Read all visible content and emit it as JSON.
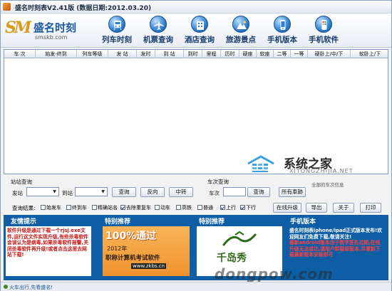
{
  "window": {
    "title": "盛名时刻表V2.41版 (数据日期:2012.03.20)"
  },
  "logo": {
    "mark": "SM",
    "name": "盛名时刻",
    "url": "smskb.com"
  },
  "nav": [
    {
      "label": "列车时刻",
      "icon": "train-icon"
    },
    {
      "label": "机票查询",
      "icon": "airplane-icon"
    },
    {
      "label": "酒店查询",
      "icon": "hotel-icon"
    },
    {
      "label": "旅游景点",
      "icon": "scenery-icon"
    },
    {
      "label": "手机版本",
      "icon": "phone-icon"
    },
    {
      "label": "手机软件",
      "icon": "mobile-app-icon"
    }
  ],
  "table": {
    "columns": [
      "车  次",
      "始发-终到",
      "列车等级",
      "发  站",
      "发时",
      "到  站",
      "到时",
      "里程",
      "历时",
      "硬座",
      "软座",
      "二等",
      "一等",
      "硬卧上/中/下",
      "软卧上/下"
    ]
  },
  "watermark": {
    "text": "系统之家",
    "sub": "XITONGZHIJIA.NET"
  },
  "station_query": {
    "title": "站站查询",
    "from_label": "发站",
    "to_label": "到站",
    "buttons": [
      "查询",
      "反向",
      "中转"
    ]
  },
  "train_query": {
    "title": "车次查询",
    "label": "车次",
    "query_button": "查询",
    "all_button": "所有車跡",
    "extra_label": "全部的车次信息"
  },
  "filters": {
    "label": "查询结果:",
    "items": [
      {
        "label": "始发车",
        "checked": false
      },
      {
        "label": "终到车",
        "checked": false
      },
      {
        "label": "精确站名",
        "checked": false
      },
      {
        "label": "去除重复车",
        "checked": true
      },
      {
        "label": "动车",
        "checked": false
      },
      {
        "label": "高铁",
        "checked": false
      },
      {
        "label": "普通",
        "checked": false
      },
      {
        "label": "上行",
        "checked": true
      },
      {
        "label": "下行",
        "checked": true
      }
    ],
    "buttons": [
      "在线升级",
      "导出",
      "关于",
      "打印"
    ]
  },
  "promo": {
    "friendly_tip": {
      "title": "友情提示",
      "text": "软件升级是通过下载一个rjsj.exe文件,运行这文件实现升级,有些杀毒软件会误认为是病毒,如果杀毒软件报警,关闭杀毒软件再升级!或者点击这里去网站下载!"
    },
    "recommend1": {
      "title": "特别推荐",
      "big": "100%通过",
      "line1": "2012年",
      "line2": "职称计算机考试软件",
      "url": "www.zkbs.cn"
    },
    "recommend2": {
      "title": "特别推荐",
      "name": "千岛秀"
    },
    "mobile": {
      "title": "手机版本",
      "text1": "盛名时刻表iphone/ipad正式版本发布!欢迎网友们免费下载,敬请关注!",
      "text2": "最新android版本由于数字签名过期,在线升级无法成功,请用户卸载原版本,并重新下载最新版本安装即可"
    }
  },
  "status": {
    "text": "火车出行,先看盛名!"
  },
  "brand_mark": "dongpow.com"
}
